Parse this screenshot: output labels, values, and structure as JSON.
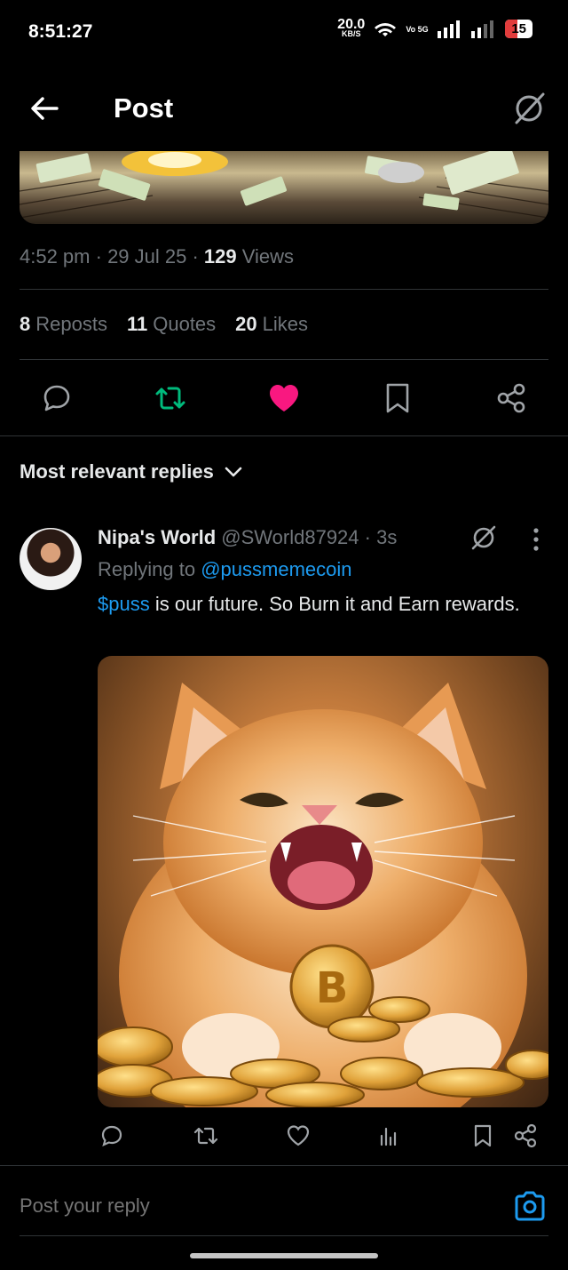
{
  "status_bar": {
    "time": "8:51:27",
    "net_speed_value": "20.0",
    "net_speed_unit": "KB/S",
    "volte": "Vo 5G",
    "battery": "15"
  },
  "header": {
    "title": "Post",
    "back_icon": "arrow-left-icon",
    "grok_icon": "grok-icon"
  },
  "post": {
    "time": "4:52 pm",
    "date": "29 Jul 25",
    "views_count": "129",
    "views_label": "Views",
    "reposts_count": "8",
    "reposts_label": "Reposts",
    "quotes_count": "11",
    "quotes_label": "Quotes",
    "likes_count": "20",
    "likes_label": "Likes",
    "liked": true,
    "reposted": true,
    "colors": {
      "repost": "#00ba7c",
      "like": "#f91880",
      "link": "#1d9bf0"
    }
  },
  "replies_filter": {
    "label": "Most relevant replies"
  },
  "reply": {
    "name": "Nipa's World",
    "handle": "@SWorld87924",
    "time": "3s",
    "replying_prefix": "Replying to",
    "replying_to": "@pussmemecoin",
    "cashtag": "$puss",
    "text": " is our future. So Burn it and Earn rewards."
  },
  "compose": {
    "placeholder": "Post your reply"
  }
}
